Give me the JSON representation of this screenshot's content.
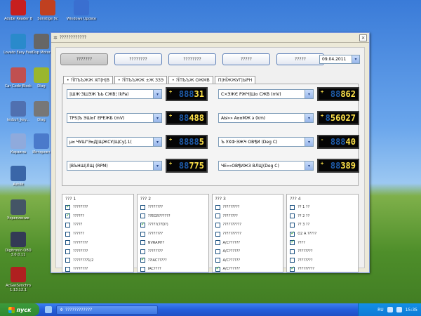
{
  "desktop": {
    "icons": [
      {
        "label": "Adobe Reader 8",
        "color": "#c71f1f"
      },
      {
        "label": "Sonstige 9c",
        "color": "#c04020"
      },
      {
        "label": "Windows Update",
        "color": "#3a6fd0"
      },
      {
        "label": "Lovato Easy Fast",
        "color": "#2a8acb"
      },
      {
        "label": "Dsp Motor",
        "color": "#666"
      },
      {
        "label": "Car Code Block",
        "color": "#c05050"
      },
      {
        "label": "Diag",
        "color": "#9ab62d"
      },
      {
        "label": "lesbuh_key...",
        "color": "#5070b0"
      },
      {
        "label": "Diag",
        "color": "#777"
      },
      {
        "label": "Корзина",
        "color": "#8faadc"
      },
      {
        "label": "Интернет",
        "color": "#4a7acb"
      },
      {
        "label": "Ashilit",
        "color": "#3a66a8"
      },
      {
        "label": "Укрепление",
        "color": "#445566"
      },
      {
        "label": "Digitronic-OBD 3.0.0.11",
        "color": "#333a55"
      },
      {
        "label": "AcGasSynchro 1.13.12.1",
        "color": "#b02020"
      }
    ]
  },
  "window": {
    "title": "????????????",
    "close_label": "×",
    "top_buttons": [
      "???????",
      "????????",
      "????????",
      "?????",
      "?????"
    ],
    "date": "09.04.2011",
    "tabs": [
      "• ?ЇПЪЪЖЖ ХП|Н|В",
      "• ?ЇПЪЪЖЖ ±Ж ЗЗЭ",
      "• ?ЇПЪЪЖ ОЖМВ",
      "П|НЇЖЖУГ|ЫРН"
    ],
    "params": [
      {
        "label": "|ШЖ·ЗШЭЖ ЪЬ СЖВ¦ (kPa)",
        "ghost": "888",
        "value": "31",
        "sign": "+"
      },
      {
        "label": "С×ЭЖЄ РЖЧ|Ш¤ СЖВ (mV)",
        "ghost": "88",
        "value": "862",
        "sign": "+"
      },
      {
        "label": "TPS|Ъ ЭШ¤Г ЕРЕЖБ (mV)",
        "ghost": "88",
        "value": "488",
        "sign": "+"
      },
      {
        "label": "АЫ»» А¤¤МЖ э (km)",
        "ghost": "8",
        "value": "56027",
        "sign": "+"
      },
      {
        "label": "µ¤ ЧУШ\"Э¤Д|ЩЖСУ|ЩСу[.1(",
        "ghost": "8888",
        "value": "5",
        "sign": "+"
      },
      {
        "label": "Ъ УХФ·ЭЖЧ ОВ¶И (Deg C)",
        "ghost": "888",
        "value": "40",
        "sign": "-"
      },
      {
        "label": "|ВЪНШ|ЛЩ (RPM)",
        "ghost": "88",
        "value": "775",
        "sign": "+"
      },
      {
        "label": "ЧЕ»»ОВ¶ИЖЗ ВЛЦ|(Deg C)",
        "ghost": "88",
        "value": "389",
        "sign": "+"
      }
    ],
    "groups": [
      {
        "title": "??? 1",
        "items": [
          {
            "label": "????????",
            "checked": true
          },
          {
            "label": "??????",
            "checked": true
          },
          {
            "label": "?????",
            "checked": false
          },
          {
            "label": "??????",
            "checked": false
          },
          {
            "label": "????????",
            "checked": false
          },
          {
            "label": "????????",
            "checked": false
          },
          {
            "label": "????????1/2",
            "checked": false
          },
          {
            "label": "????????",
            "checked": false
          }
        ]
      },
      {
        "title": "??? 2",
        "items": [
          {
            "label": "????????",
            "checked": false
          },
          {
            "label": "??EGR??????",
            "checked": false
          },
          {
            "label": "?????(??D?)",
            "checked": true
          },
          {
            "label": "????????",
            "checked": false
          },
          {
            "label": "NVRAM??",
            "checked": false
          },
          {
            "label": "????????",
            "checked": false
          },
          {
            "label": "??IAC?????",
            "checked": true
          },
          {
            "label": "IAC????",
            "checked": false
          }
        ]
      },
      {
        "title": "??? 3",
        "items": [
          {
            "label": "?????????",
            "checked": false
          },
          {
            "label": "????????",
            "checked": false
          },
          {
            "label": "??????????",
            "checked": false
          },
          {
            "label": "??????????",
            "checked": false
          },
          {
            "label": "A/C??????",
            "checked": false
          },
          {
            "label": "A/C??????",
            "checked": false
          },
          {
            "label": "A/C??????",
            "checked": false
          },
          {
            "label": "A/C??????",
            "checked": true
          }
        ]
      },
      {
        "title": "??? 4",
        "items": [
          {
            "label": "?? 1 ??",
            "checked": false
          },
          {
            "label": "?? 2 ??",
            "checked": false
          },
          {
            "label": "?? 3 ??",
            "checked": false
          },
          {
            "label": "O2 A ?????",
            "checked": true
          },
          {
            "label": "????",
            "checked": true
          },
          {
            "label": "????????",
            "checked": false
          },
          {
            "label": "????????",
            "checked": false
          },
          {
            "label": "?????????",
            "checked": true
          }
        ]
      }
    ]
  },
  "taskbar": {
    "start_label": "пуск",
    "task_label": "????????????",
    "lang": "RU",
    "clock": "15:35"
  },
  "colors": {
    "lcd_value": "#ffe34a",
    "lcd_ghost": "#1e5aa8",
    "check": "#21a121",
    "taskbar": "#245edb"
  }
}
